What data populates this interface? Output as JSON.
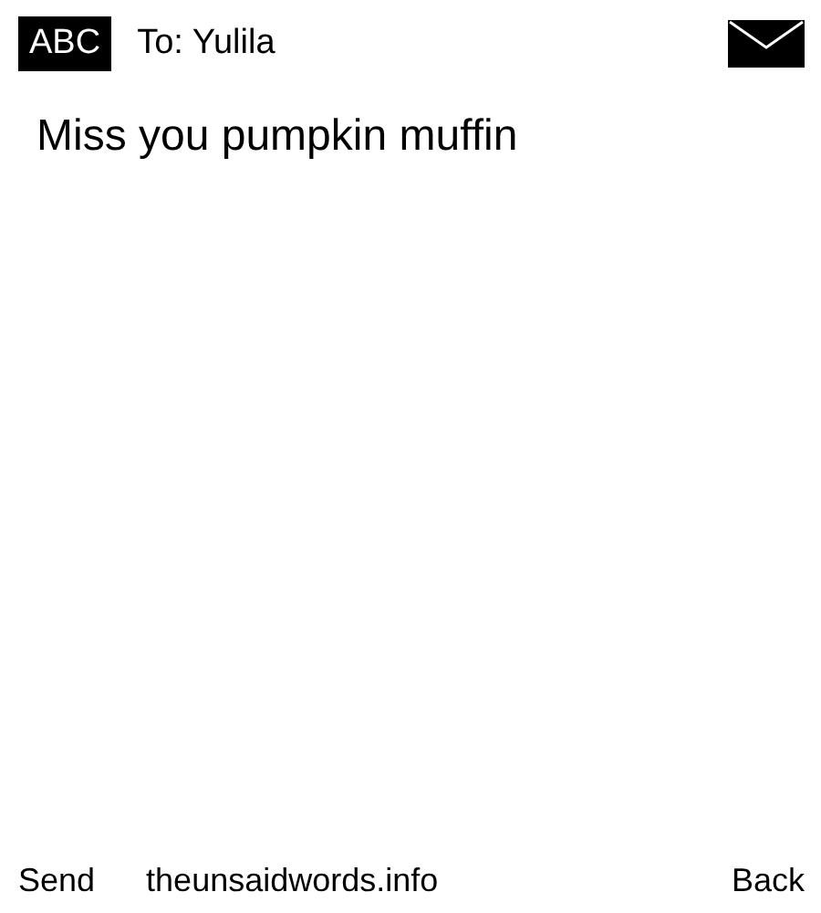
{
  "header": {
    "input_mode": "ABC",
    "recipient": "To: Yulila"
  },
  "message": "Miss you pumpkin muffin",
  "softkeys": {
    "left": "Send",
    "center": "theunsaidwords.info",
    "right": "Back"
  }
}
